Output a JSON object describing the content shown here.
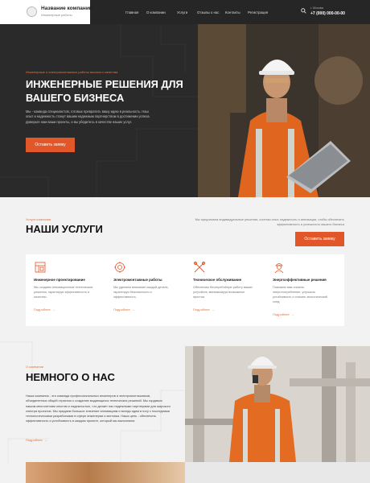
{
  "header": {
    "company_name": "Название компании",
    "company_tagline": "Инженерные работы",
    "nav": [
      "Главная",
      "О компании",
      "Услуги",
      "Отзывы о нас",
      "Контакты",
      "Регистрация"
    ],
    "search_icon": "search-icon",
    "city": "г. Москва",
    "phone": "+7 (000) 000-00-00"
  },
  "hero": {
    "kicker": "Инженерные и электромонтажные работы высокого качества",
    "title": "Инженерные решения для вашего бизнеса",
    "description": "Мы - команда специалистов, готовых превратить вашу идею в реальность. Наш опыт и надежность станут вашим надежным партнерством в достижении успеха. Доверьте нам ваши проекты, и вы убедитесь в качестве наших услуг.",
    "cta": "Оставить заявку"
  },
  "services": {
    "kicker": "Услуги компании",
    "title": "НАШИ УСЛУГИ",
    "description": "Мы предлагаем индивидуальные решения, сочетая опыт, надежность и инновации, чтобы обеспечить эффективность и успешность вашего бизнеса",
    "cta": "Оставить заявку",
    "items": [
      {
        "icon": "blueprint-icon",
        "title": "Инженерное проектирование",
        "text": "Мы создаем инновационные технические решения, гарантируя эффективность и качество.",
        "link": "Подробнее"
      },
      {
        "icon": "gear-icon",
        "title": "Электромонтажные работы",
        "text": "Мы уделяем внимание каждой детали, гарантируя безопасность и эффективность.",
        "link": "Подробнее"
      },
      {
        "icon": "tools-icon",
        "title": "Техническое обслуживание",
        "text": "Обеспечим бесперебойную работу ваших устройств, минимизируя возможные простои.",
        "link": "Подробнее"
      },
      {
        "icon": "engineer-icon",
        "title": "Энергоэффективные решения",
        "text": "Поможем вам снизить энергопотребление, улучшить устойчивость и снизить экологический след.",
        "link": "Подробнее"
      }
    ]
  },
  "about": {
    "kicker": "О компании",
    "title": "НЕМНОГО О НАС",
    "description": "Наша компания - это команда профессиональных инженеров и электромонтажников, объединенных общей страстью к созданию выдающихся технических решений. Мы гордимся нашим многолетним опытом и надежностью, что делает нас надежными партнерами для широкого спектра проектов. Мы придаем большое значение инновациям и всегда идем в ногу с последними технологическими разработками в сфере инженерии и монтажа. Наша цель - обеспечить эффективность и устойчивость в каждом проекте, который мы выполняем.",
    "link": "Подробнее"
  },
  "colors": {
    "accent": "#e2572a",
    "dark": "#262626",
    "light_bg": "#f2f2f2"
  }
}
